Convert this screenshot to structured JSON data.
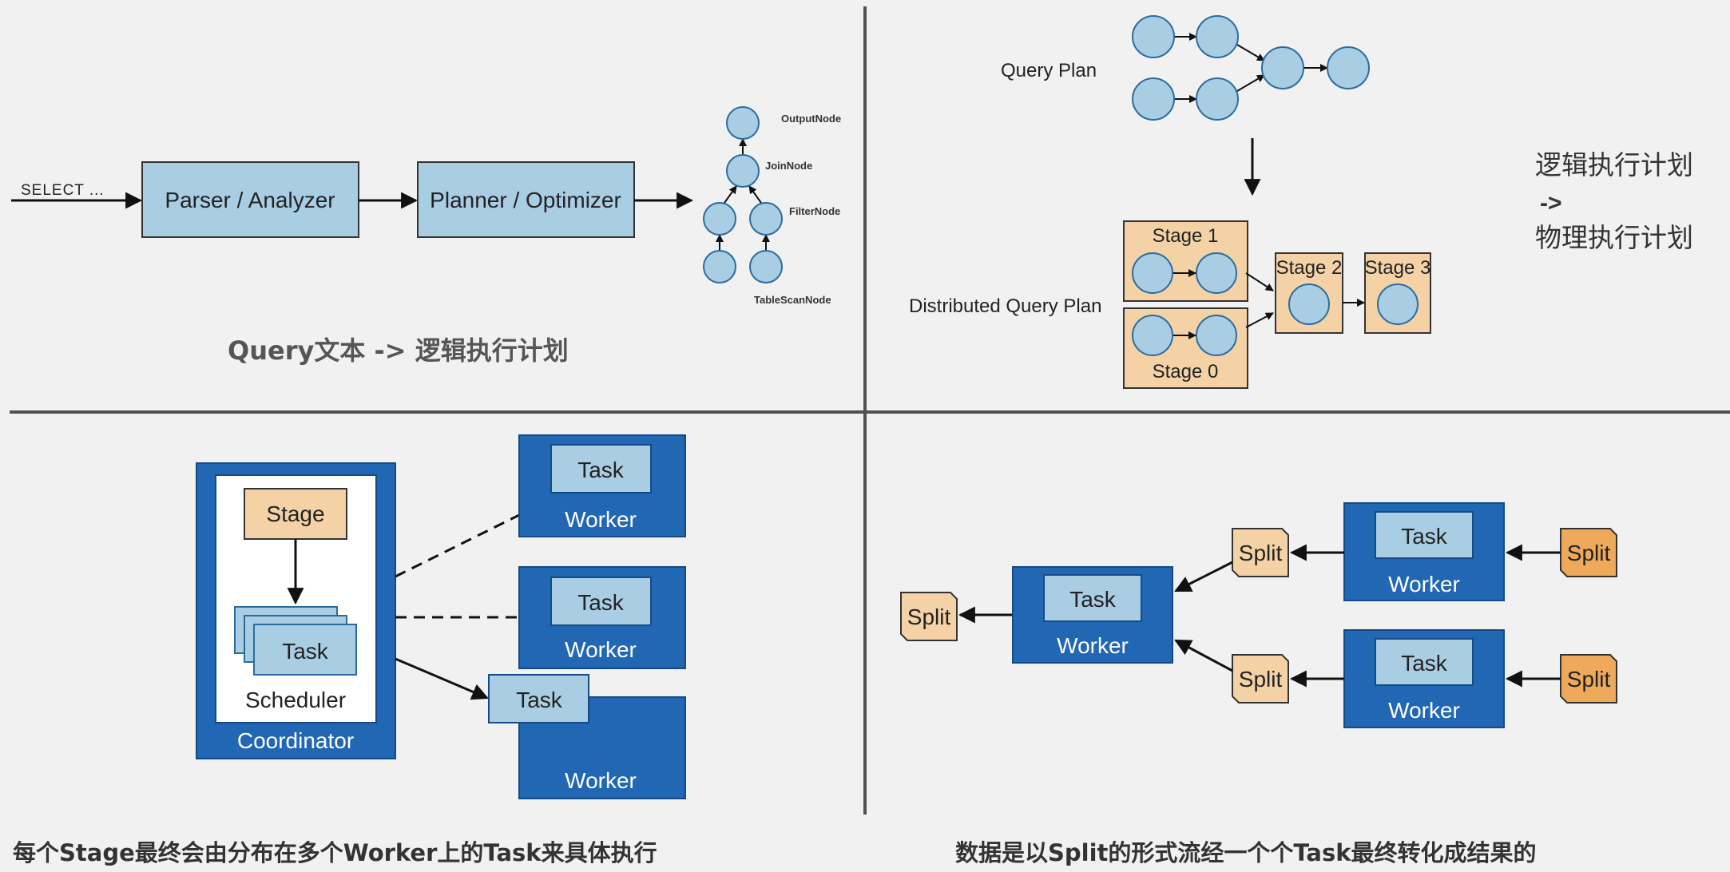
{
  "q1": {
    "input": "SELECT ...",
    "parser": "Parser / Analyzer",
    "planner": "Planner / Optimizer",
    "tree_labels": [
      "OutputNode",
      "JoinNode",
      "FilterNode",
      "TableScanNode"
    ],
    "caption": "Query文本 -> 逻辑执行计划"
  },
  "q2": {
    "query_plan": "Query Plan",
    "distributed": "Distributed Query Plan",
    "stages": [
      "Stage 1",
      "Stage 0",
      "Stage 2",
      "Stage 3"
    ],
    "side_text": [
      "逻辑执行计划",
      "->",
      "物理执行计划"
    ]
  },
  "q3": {
    "stage": "Stage",
    "task": "Task",
    "scheduler": "Scheduler",
    "coordinator": "Coordinator",
    "worker": "Worker",
    "caption": "每个Stage最终会由分布在多个Worker上的Task来具体执行"
  },
  "q4": {
    "split": "Split",
    "task": "Task",
    "worker": "Worker",
    "caption": "数据是以Split的形式流经一个个Task最终转化成结果的"
  },
  "colors": {
    "light_blue": "#a9cde3",
    "dark_blue": "#2167b3",
    "light_orange": "#f4d2a6",
    "orange": "#eea95a",
    "line": "#111111",
    "divider": "#505050"
  }
}
